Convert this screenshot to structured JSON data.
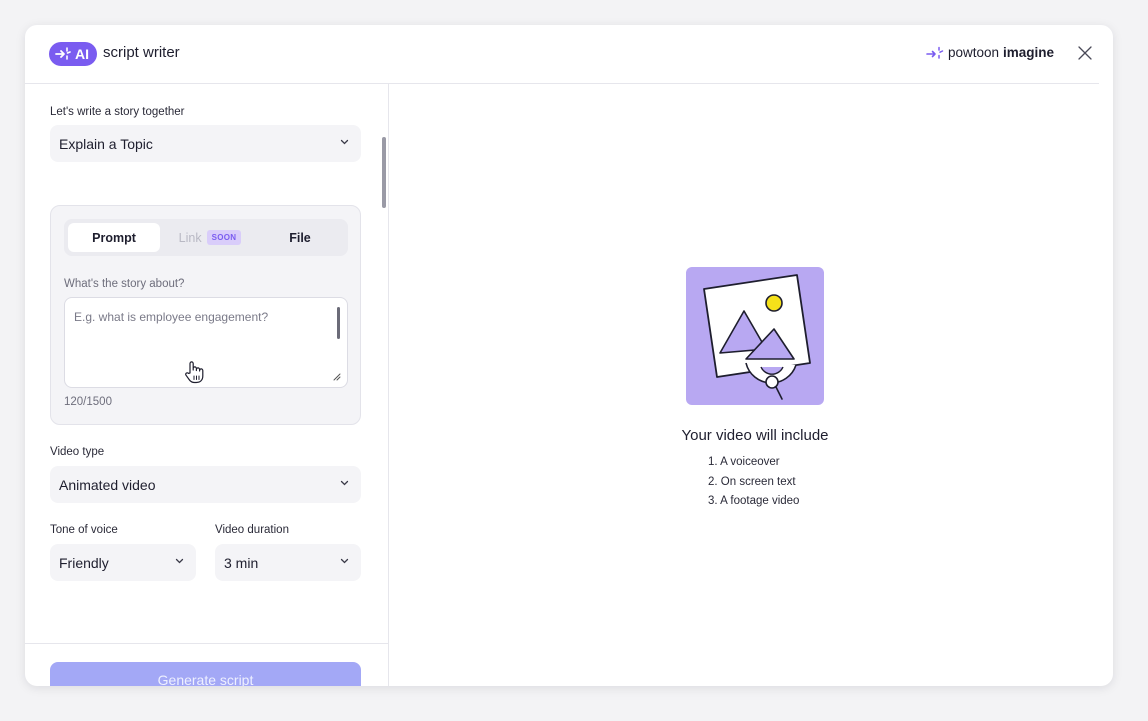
{
  "header": {
    "badge": "AI",
    "title": "script writer",
    "brand_light": "powtoon",
    "brand_bold": "imagine"
  },
  "form": {
    "story_label": "Let's write a story together",
    "story_type": "Explain a Topic",
    "tabs": {
      "prompt": "Prompt",
      "link": "Link",
      "soon": "SOON",
      "file": "File"
    },
    "prompt_label": "What's the story about?",
    "prompt_placeholder": "E.g. what is employee engagement?",
    "char_count": "120/1500",
    "video_type_label": "Video type",
    "video_type": "Animated video",
    "tone_label": "Tone of voice",
    "tone": "Friendly",
    "duration_label": "Video duration",
    "duration": "3 min",
    "generate_label": "Generate script"
  },
  "preview": {
    "title": "Your video will include",
    "items": [
      "1. A voiceover",
      "2. On screen text",
      "3. A footage video"
    ]
  },
  "colors": {
    "accent": "#7a5cf0",
    "button": "#a3a8f6",
    "illustration_bg": "#b8a8f2",
    "sun": "#f5e11a"
  }
}
